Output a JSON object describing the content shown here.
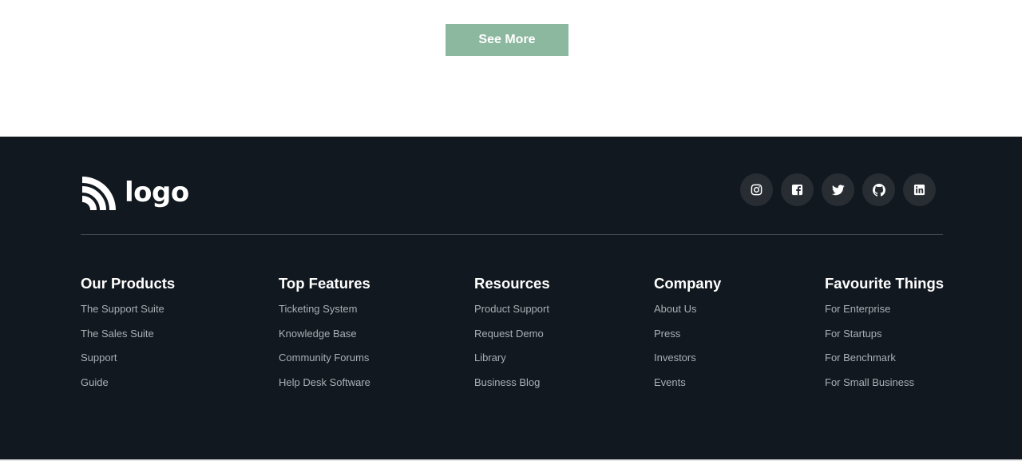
{
  "cta": {
    "see_more_label": "See More",
    "button_color": "#8db8a0"
  },
  "footer": {
    "background": "#12181f",
    "logo_text": "logo",
    "social_icons": [
      "instagram-icon",
      "facebook-icon",
      "twitter-icon",
      "github-icon",
      "linkedin-icon"
    ],
    "columns": [
      {
        "title": "Our Products",
        "links": [
          "The Support Suite",
          "The Sales Suite",
          "Support",
          "Guide"
        ]
      },
      {
        "title": "Top Features",
        "links": [
          "Ticketing System",
          "Knowledge Base",
          "Community Forums",
          "Help Desk Software"
        ]
      },
      {
        "title": "Resources",
        "links": [
          "Product Support",
          "Request Demo",
          "Library",
          "Business Blog"
        ]
      },
      {
        "title": "Company",
        "links": [
          "About Us",
          "Press",
          "Investors",
          "Events"
        ]
      },
      {
        "title": "Favourite Things",
        "links": [
          "For Enterprise",
          "For Startups",
          "For Benchmark",
          "For Small Business"
        ]
      }
    ]
  }
}
